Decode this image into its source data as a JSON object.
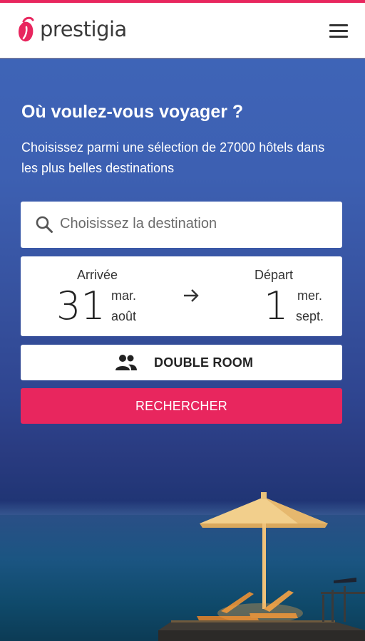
{
  "brand": {
    "name": "prestigia",
    "accent_color": "#e8265e"
  },
  "header": {
    "menu_icon": "hamburger-menu-icon"
  },
  "hero": {
    "title": "Où voulez-vous voyager ?",
    "subtitle": "Choisissez parmi une sélection de 27000 hôtels dans les plus belles destinations"
  },
  "search": {
    "icon": "search-icon",
    "placeholder": "Choisissez la destination"
  },
  "dates": {
    "arrival": {
      "label": "Arrivée",
      "day": "31",
      "weekday": "mar.",
      "month": "août"
    },
    "departure": {
      "label": "Départ",
      "day": "1",
      "weekday": "mer.",
      "month": "sept."
    },
    "arrow_icon": "arrow-right-icon"
  },
  "room": {
    "icon": "people-icon",
    "label": "DOUBLE ROOM"
  },
  "actions": {
    "search_label": "RECHERCHER"
  }
}
